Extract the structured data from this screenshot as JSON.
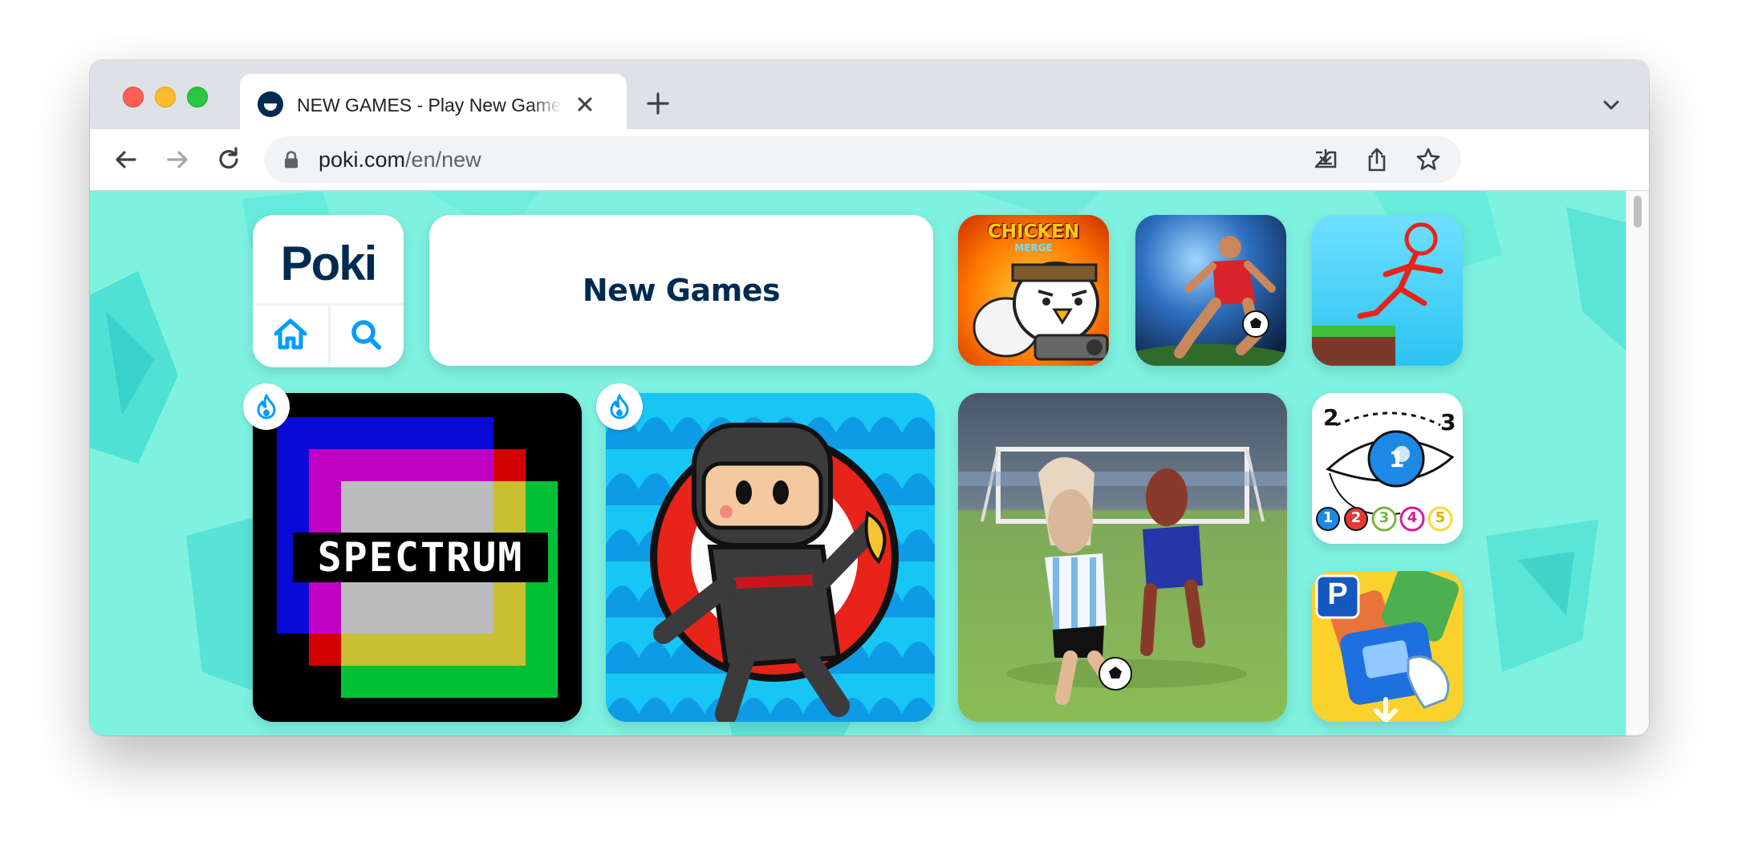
{
  "browser": {
    "tab_title": "NEW GAMES - Play New Games",
    "url_host": "poki.com",
    "url_path": "/en/new"
  },
  "site": {
    "logo_text": "Poki",
    "page_title": "New Games",
    "accent_color": "#009cff",
    "brand_color": "#002b50",
    "background_color": "#7ff1df"
  },
  "games": {
    "spectrum": {
      "label": "SPECTRUM",
      "badge": "fire-icon"
    },
    "ninja": {
      "badge": "fire-icon"
    },
    "chicken_merge": {
      "label_top": "CHICKEN",
      "label_bottom": "MERGE"
    },
    "eye_puzzle": {
      "numbers_top": [
        "2",
        "3"
      ],
      "numbers_bottom": [
        "1",
        "2",
        "3",
        "4",
        "5"
      ],
      "center_number": "1"
    },
    "parking": {
      "sign": "P"
    }
  }
}
